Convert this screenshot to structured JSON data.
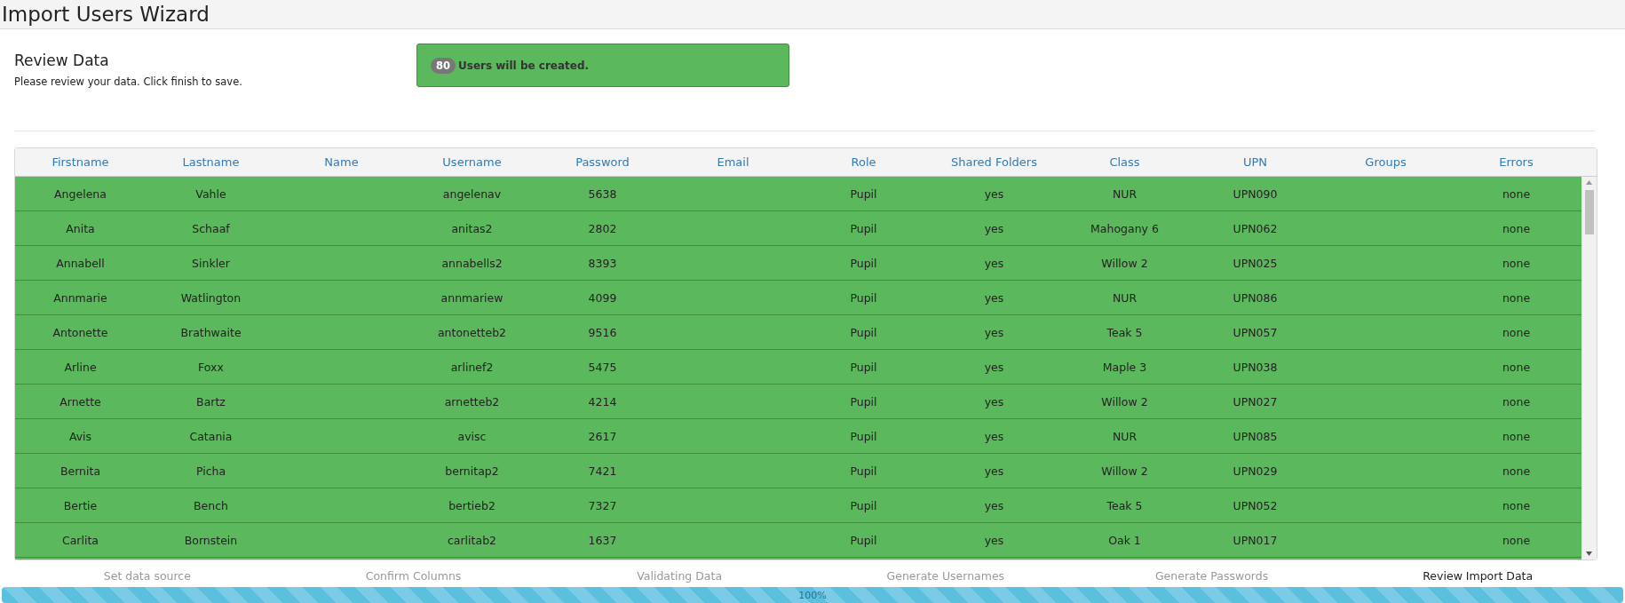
{
  "window": {
    "title": "Import Users Wizard"
  },
  "section": {
    "title": "Review Data",
    "description": "Please review your data. Click finish to save."
  },
  "alert": {
    "count": "80",
    "message": "Users will be created."
  },
  "table": {
    "columns": [
      "Firstname",
      "Lastname",
      "Name",
      "Username",
      "Password",
      "Email",
      "Role",
      "Shared Folders",
      "Class",
      "UPN",
      "Groups",
      "Errors"
    ],
    "rows": [
      [
        "Angelena",
        "Vahle",
        "",
        "angelenav",
        "5638",
        "",
        "Pupil",
        "yes",
        "NUR",
        "UPN090",
        "",
        "none"
      ],
      [
        "Anita",
        "Schaaf",
        "",
        "anitas2",
        "2802",
        "",
        "Pupil",
        "yes",
        "Mahogany 6",
        "UPN062",
        "",
        "none"
      ],
      [
        "Annabell",
        "Sinkler",
        "",
        "annabells2",
        "8393",
        "",
        "Pupil",
        "yes",
        "Willow 2",
        "UPN025",
        "",
        "none"
      ],
      [
        "Annmarie",
        "Watlington",
        "",
        "annmariew",
        "4099",
        "",
        "Pupil",
        "yes",
        "NUR",
        "UPN086",
        "",
        "none"
      ],
      [
        "Antonette",
        "Brathwaite",
        "",
        "antonetteb2",
        "9516",
        "",
        "Pupil",
        "yes",
        "Teak 5",
        "UPN057",
        "",
        "none"
      ],
      [
        "Arline",
        "Foxx",
        "",
        "arlinef2",
        "5475",
        "",
        "Pupil",
        "yes",
        "Maple 3",
        "UPN038",
        "",
        "none"
      ],
      [
        "Arnette",
        "Bartz",
        "",
        "arnetteb2",
        "4214",
        "",
        "Pupil",
        "yes",
        "Willow 2",
        "UPN027",
        "",
        "none"
      ],
      [
        "Avis",
        "Catania",
        "",
        "avisc",
        "2617",
        "",
        "Pupil",
        "yes",
        "NUR",
        "UPN085",
        "",
        "none"
      ],
      [
        "Bernita",
        "Picha",
        "",
        "bernitap2",
        "7421",
        "",
        "Pupil",
        "yes",
        "Willow 2",
        "UPN029",
        "",
        "none"
      ],
      [
        "Bertie",
        "Bench",
        "",
        "bertieb2",
        "7327",
        "",
        "Pupil",
        "yes",
        "Teak 5",
        "UPN052",
        "",
        "none"
      ],
      [
        "Carlita",
        "Bornstein",
        "",
        "carlitab2",
        "1637",
        "",
        "Pupil",
        "yes",
        "Oak 1",
        "UPN017",
        "",
        "none"
      ]
    ]
  },
  "steps": [
    {
      "label": "Set data source",
      "selected": false
    },
    {
      "label": "Confirm Columns",
      "selected": false
    },
    {
      "label": "Validating Data",
      "selected": false
    },
    {
      "label": "Generate Usernames",
      "selected": false
    },
    {
      "label": "Generate Passwords",
      "selected": false
    },
    {
      "label": "Review Import Data",
      "selected": true
    }
  ],
  "progress": {
    "level": 1,
    "text": "100%"
  }
}
